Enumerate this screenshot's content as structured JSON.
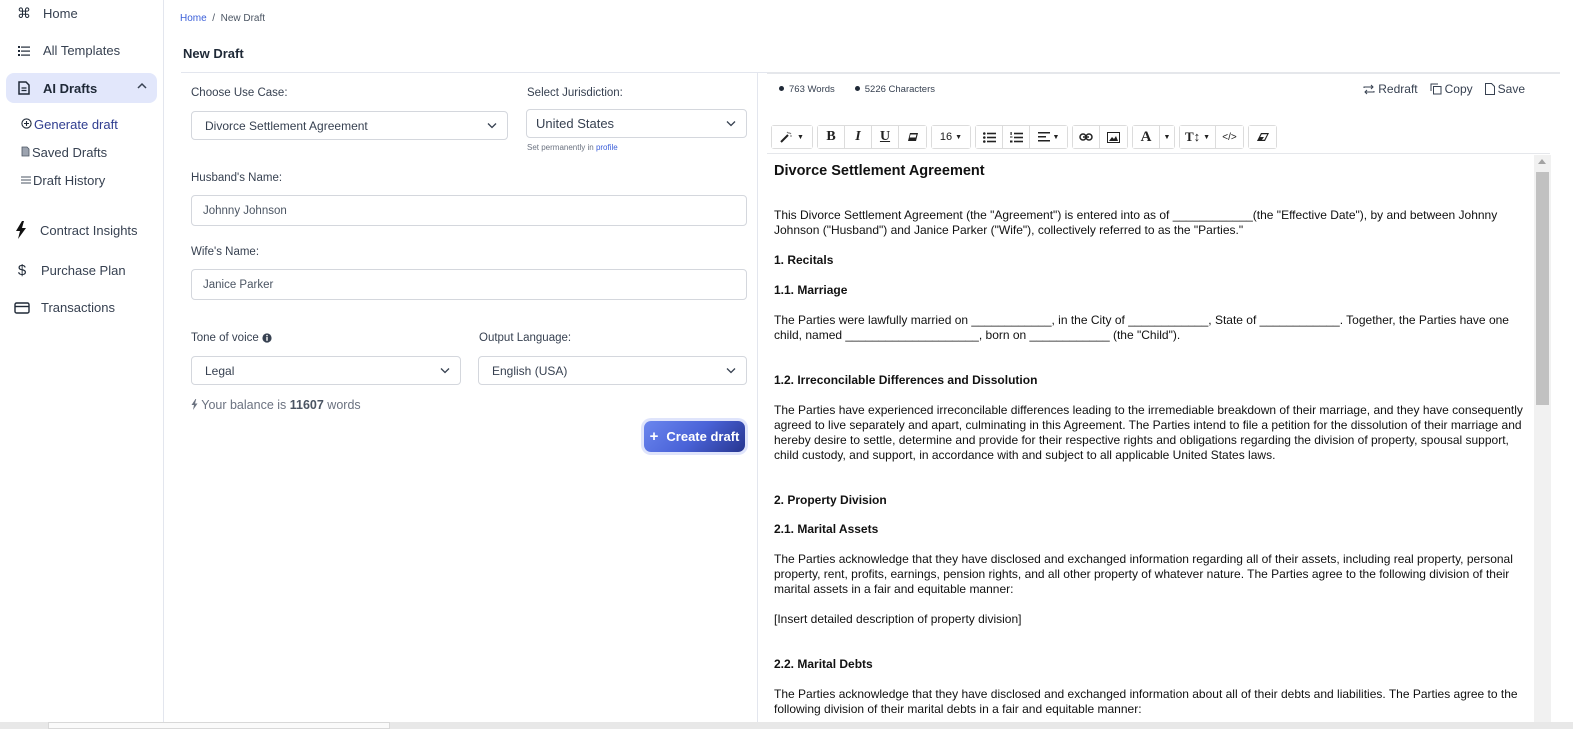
{
  "sidebar": {
    "items": [
      {
        "label": "Home",
        "icon": "command-icon"
      },
      {
        "label": "All Templates",
        "icon": "list-icon"
      },
      {
        "label": "AI Drafts",
        "icon": "document-icon",
        "expanded": true
      },
      {
        "label": "Contract Insights",
        "icon": "bolt-icon"
      },
      {
        "label": "Purchase Plan",
        "icon": "dollar-icon"
      },
      {
        "label": "Transactions",
        "icon": "credit-card-icon"
      }
    ],
    "subitems": [
      {
        "label": "Generate draft",
        "icon": "plus-circle-icon",
        "active": true
      },
      {
        "label": "Saved Drafts",
        "icon": "file-icon"
      },
      {
        "label": "Draft History",
        "icon": "menu-icon"
      }
    ]
  },
  "breadcrumb": {
    "home": "Home",
    "sep": "/",
    "current": "New Draft"
  },
  "page_title": "New Draft",
  "form": {
    "use_case_label": "Choose Use Case:",
    "use_case_value": "Divorce Settlement Agreement",
    "jurisdiction_label": "Select Jurisdiction:",
    "jurisdiction_value": "United States",
    "jurisdiction_hint": "Set permanently in ",
    "jurisdiction_hint_link": "profile",
    "husband_label": "Husband's Name:",
    "husband_value": "Johnny Johnson",
    "wife_label": "Wife's Name:",
    "wife_value": "Janice Parker",
    "tone_label": "Tone of voice",
    "tone_value": "Legal",
    "language_label": "Output Language:",
    "language_value": "English (USA)",
    "balance_prefix": "Your balance is ",
    "balance_value": "11607",
    "balance_suffix": " words",
    "create_label": "Create draft"
  },
  "editor": {
    "words": "763 Words",
    "characters": "5226 Characters",
    "actions": {
      "redraft": "Redraft",
      "copy": "Copy",
      "save": "Save"
    },
    "font_size": "16",
    "document": {
      "title": "Divorce Settlement Agreement",
      "intro": "This Divorce Settlement Agreement (the \"Agreement\") is entered into as of ____________(the \"Effective Date\"), by and between Johnny Johnson (\"Husband\") and Janice Parker (\"Wife\"), collectively referred to as the \"Parties.\"",
      "s1": "1. Recitals",
      "s1_1": "1.1. Marriage",
      "s1_1_text": "The Parties were lawfully married on ____________, in the City of ____________, State of ____________. Together, the Parties have one child, named ____________________, born on ____________ (the \"Child\").",
      "s1_2": "1.2. Irreconcilable Differences and Dissolution",
      "s1_2_text": "The Parties have experienced irreconcilable differences leading to the irremediable breakdown of their marriage, and they have consequently agreed to live separately and apart, culminating in this Agreement. The Parties intend to file a petition for the dissolution of their marriage and hereby desire to settle, determine and provide for their respective rights and obligations regarding the division of property, spousal support, child custody, and support, in accordance with and subject to all applicable United States laws.",
      "s2": "2. Property Division",
      "s2_1": "2.1. Marital Assets",
      "s2_1_text": "The Parties acknowledge that they have disclosed and exchanged information regarding all of their assets, including real property, personal property, rent, profits, earnings, pension rights, and all other property of whatever nature. The Parties agree to the following division of their marital assets in a fair and equitable manner:",
      "s2_1_placeholder": "[Insert detailed description of property division]",
      "s2_2": "2.2. Marital Debts",
      "s2_2_text": "The Parties acknowledge that they have disclosed and exchanged information about all of their debts and liabilities. The Parties agree to the following division of their marital debts in a fair and equitable manner:"
    }
  }
}
